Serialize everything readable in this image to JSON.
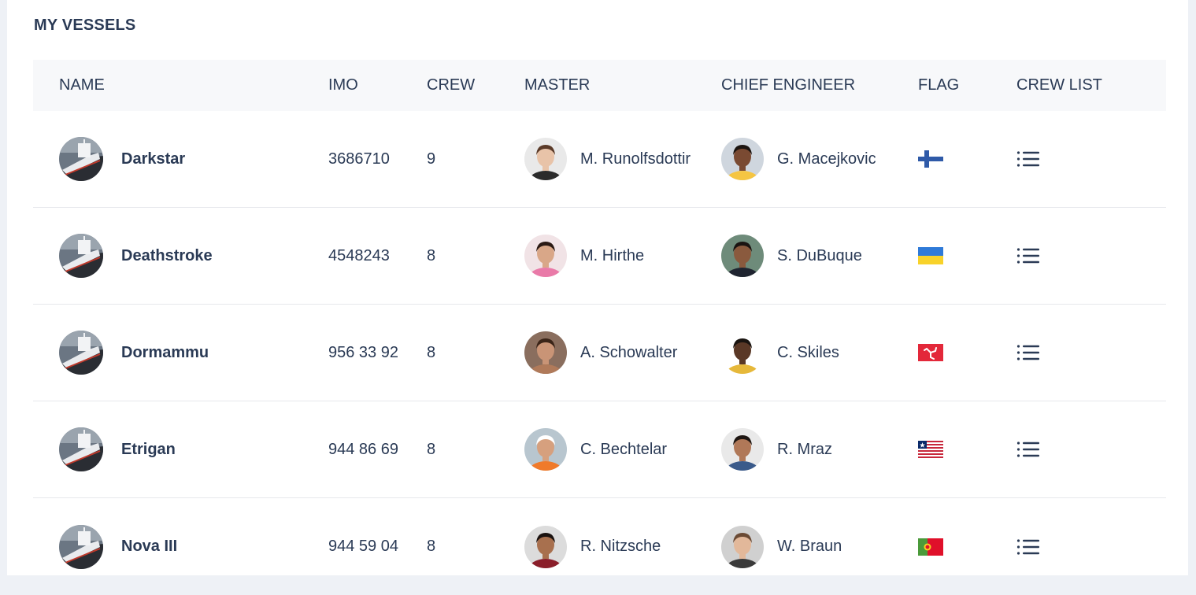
{
  "page": {
    "title": "MY VESSELS"
  },
  "table": {
    "headers": {
      "name": "NAME",
      "imo": "IMO",
      "crew": "CREW",
      "master": "MASTER",
      "chief_engineer": "CHIEF ENGINEER",
      "flag": "FLAG",
      "crew_list": "CREW LIST"
    },
    "rows": [
      {
        "name": "Darkstar",
        "imo": "3686710",
        "crew": "9",
        "master": {
          "name": "M. Runolfsdottir",
          "skin": "#e8c3a8",
          "hair": "#5a3a28",
          "shirt": "#2b2b2b",
          "bg": "#e9e9e9"
        },
        "chief_engineer": {
          "name": "G. Macejkovic",
          "skin": "#7a4a32",
          "hair": "#1b1410",
          "shirt": "#f5c542",
          "bg": "#cfd6de"
        },
        "flag": "finland",
        "flag_icon": "finland-flag-icon",
        "crew_list_icon": "list-icon"
      },
      {
        "name": "Deathstroke",
        "imo": "4548243",
        "crew": "8",
        "master": {
          "name": "M. Hirthe",
          "skin": "#d9a788",
          "hair": "#2b1a14",
          "shirt": "#e97aa8",
          "bg": "#f1e3e6"
        },
        "chief_engineer": {
          "name": "S. DuBuque",
          "skin": "#8a5a3e",
          "hair": "#1a1412",
          "shirt": "#1f2430",
          "bg": "#6e8b7a"
        },
        "flag": "ukraine",
        "flag_icon": "ukraine-flag-icon",
        "crew_list_icon": "list-icon"
      },
      {
        "name": "Dormammu",
        "imo": "956 33 92",
        "crew": "8",
        "master": {
          "name": "A. Schowalter",
          "skin": "#c99476",
          "hair": "#3a2418",
          "shirt": "#b07a5a",
          "bg": "#8a6e5e"
        },
        "chief_engineer": {
          "name": "C. Skiles",
          "skin": "#5a3826",
          "hair": "#1a1410",
          "shirt": "#e6b83a",
          "bg": "#ffffff"
        },
        "flag": "isle-of-man",
        "flag_icon": "isle-of-man-flag-icon",
        "crew_list_icon": "list-icon"
      },
      {
        "name": "Etrigan",
        "imo": "944 86 69",
        "crew": "8",
        "master": {
          "name": "C. Bechtelar",
          "skin": "#d6a07e",
          "hair": "#ffffff",
          "shirt": "#f07a2a",
          "bg": "#b8c6cf"
        },
        "chief_engineer": {
          "name": "R. Mraz",
          "skin": "#b07858",
          "hair": "#1e1612",
          "shirt": "#3a5a8a",
          "bg": "#e9e9e9"
        },
        "flag": "liberia",
        "flag_icon": "liberia-flag-icon",
        "crew_list_icon": "list-icon"
      },
      {
        "name": "Nova III",
        "imo": "944 59 04",
        "crew": "8",
        "master": {
          "name": "R. Nitzsche",
          "skin": "#a8704e",
          "hair": "#1a1210",
          "shirt": "#8a1e2a",
          "bg": "#dcdcdc"
        },
        "chief_engineer": {
          "name": "W. Braun",
          "skin": "#e2b89a",
          "hair": "#6a4a34",
          "shirt": "#3a3a3a",
          "bg": "#d0d0d0"
        },
        "flag": "portugal",
        "flag_icon": "portugal-flag-icon",
        "crew_list_icon": "list-icon"
      }
    ]
  }
}
